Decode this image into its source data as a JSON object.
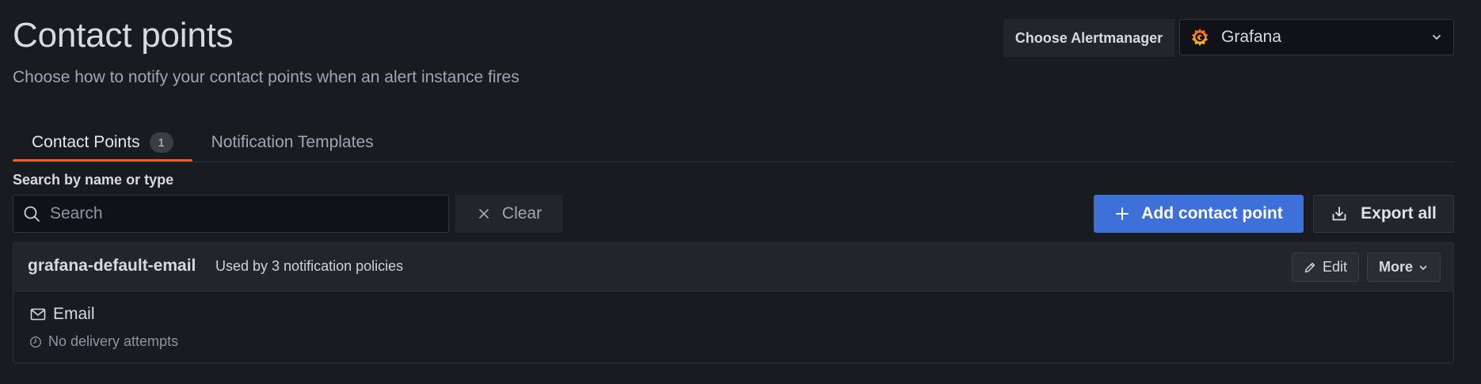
{
  "page": {
    "title": "Contact points",
    "subtitle": "Choose how to notify your contact points when an alert instance fires"
  },
  "alertmanager": {
    "label": "Choose Alertmanager",
    "selected": "Grafana",
    "logo_icon": "grafana-logo-icon",
    "chevron_icon": "chevron-down-icon"
  },
  "tabs": [
    {
      "label": "Contact Points",
      "count": "1",
      "active": true
    },
    {
      "label": "Notification Templates",
      "active": false
    }
  ],
  "search": {
    "label": "Search by name or type",
    "placeholder": "Search",
    "value": "",
    "icon": "search-icon",
    "clear_label": "Clear",
    "clear_icon": "close-icon"
  },
  "actions": {
    "add_label": "Add contact point",
    "add_icon": "plus-icon",
    "export_label": "Export all",
    "export_icon": "download-icon"
  },
  "contact_points": [
    {
      "name": "grafana-default-email",
      "usage": "Used by 3 notification policies",
      "edit_label": "Edit",
      "more_label": "More",
      "integrations": [
        {
          "type": "Email",
          "icon": "envelope-icon",
          "status": "No delivery attempts",
          "status_icon": "clock-icon"
        }
      ]
    }
  ],
  "colors": {
    "background": "#181b1f",
    "accent_tab": "#f05a28",
    "primary_button": "#3d71d9"
  }
}
